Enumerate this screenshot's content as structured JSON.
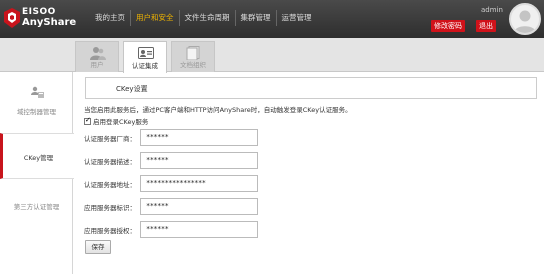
{
  "header": {
    "logo_line1": "EISOO",
    "logo_line2": "AnyShare",
    "nav": [
      {
        "label": "我的主页"
      },
      {
        "label": "用户和安全",
        "active": true
      },
      {
        "label": "文件生命周期"
      },
      {
        "label": "集群管理"
      },
      {
        "label": "运营管理"
      }
    ],
    "user": "admin",
    "change_password": "修改密码",
    "logout": "退出"
  },
  "tabs": [
    {
      "label": "用户",
      "icon": "users-icon"
    },
    {
      "label": "认证集成",
      "icon": "id-card-icon",
      "active": true
    },
    {
      "label": "文档组织",
      "icon": "documents-icon"
    }
  ],
  "sidebar": [
    {
      "label": "域控制器管理",
      "icon": "domain-controller-icon"
    },
    {
      "label": "CKey管理",
      "active": true
    },
    {
      "label": "第三方认证管理"
    }
  ],
  "main": {
    "section_title": "CKey设置",
    "description": "当您启用此服务后，通过PC客户端和HTTP访问AnyShare时，自动触发登录CKey认证服务。",
    "enable_label": "启用登录CKey服务",
    "enable_checked": true,
    "fields": [
      {
        "label": "认证服务器厂商：",
        "value": "******"
      },
      {
        "label": "认证服务器描述：",
        "value": "******"
      },
      {
        "label": "认证服务器地址：",
        "value": "****************"
      },
      {
        "label": "应用服务器标识：",
        "value": "******"
      },
      {
        "label": "应用服务器授权：",
        "value": "******"
      }
    ],
    "save_label": "保存"
  },
  "colors": {
    "accent_red": "#d0121a",
    "active_nav": "#f0b400",
    "header_bg": "#3a3a3a"
  }
}
